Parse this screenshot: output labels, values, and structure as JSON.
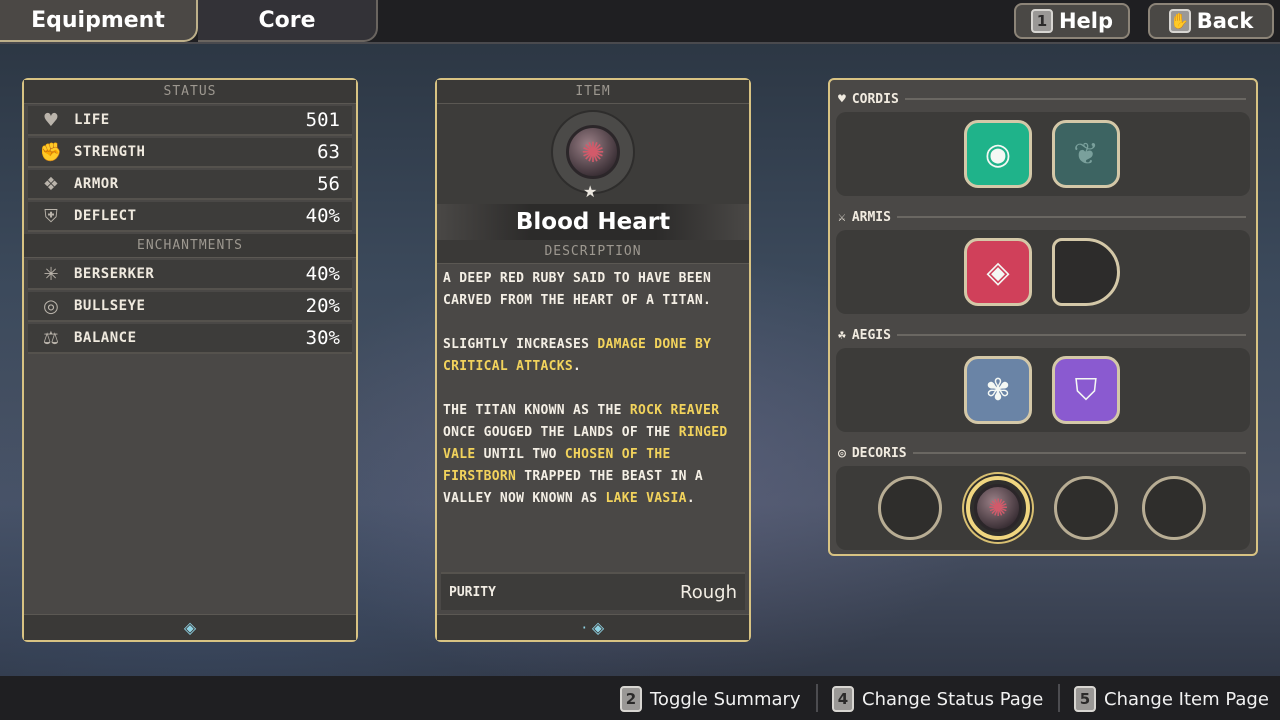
{
  "tabs": [
    {
      "label": "Equipment"
    },
    {
      "label": "Core"
    }
  ],
  "top_buttons": [
    {
      "key": "1",
      "label": "Help"
    },
    {
      "key": "✋",
      "label": "Back"
    }
  ],
  "status": {
    "header": "STATUS",
    "rows": [
      {
        "icon": "heart-icon",
        "glyph": "♥",
        "label": "LIFE",
        "value": "501"
      },
      {
        "icon": "fist-icon",
        "glyph": "✊",
        "label": "STRENGTH",
        "value": "63"
      },
      {
        "icon": "armor-icon",
        "glyph": "❖",
        "label": "ARMOR",
        "value": "56"
      },
      {
        "icon": "shield-icon",
        "glyph": "⛨",
        "label": "DEFLECT",
        "value": "40%"
      }
    ],
    "ench_header": "ENCHANTMENTS",
    "enchantments": [
      {
        "icon": "berserker-icon",
        "glyph": "✳",
        "label": "BERSERKER",
        "value": "40%"
      },
      {
        "icon": "bullseye-icon",
        "glyph": "◎",
        "label": "BULLSEYE",
        "value": "20%"
      },
      {
        "icon": "balance-icon",
        "glyph": "⚖",
        "label": "BALANCE",
        "value": "30%"
      }
    ],
    "footer_glyph": "◈"
  },
  "item": {
    "header": "ITEM",
    "name": "Blood Heart",
    "desc_header": "DESCRIPTION",
    "p1": "A DEEP RED RUBY SAID TO HAVE BEEN CARVED FROM THE HEART OF A TITAN.",
    "p2a": "SLIGHTLY INCREASES ",
    "p2b": "DAMAGE DONE BY CRITICAL ATTACKS",
    "p2c": ".",
    "p3a": "THE TITAN KNOWN AS THE ",
    "p3b": "ROCK REAVER",
    "p3c": " ONCE GOUGED THE LANDS OF THE ",
    "p3d": "RINGED VALE",
    "p3e": " UNTIL TWO ",
    "p3f": "CHOSEN OF THE FIRSTBORN",
    "p3g": " TRAPPED THE BEAST IN A VALLEY NOW KNOWN AS ",
    "p3h": "LAKE VASIA",
    "p3i": ".",
    "purity_label": "PURITY",
    "purity_value": "Rough",
    "footer_glyph": "· ◈"
  },
  "slots": {
    "cordis": {
      "label": "CORDIS",
      "glyph": "♥"
    },
    "armis": {
      "label": "ARMIS",
      "glyph": "⚔"
    },
    "aegis": {
      "label": "AEGIS",
      "glyph": "☘"
    },
    "decoris": {
      "label": "DECORIS",
      "glyph": "◎"
    }
  },
  "colors": {
    "panel_border": "#d8c383",
    "highlight": "#f2d35c",
    "gem_green": "#1fb38a",
    "gem_teal_dim": "#3d6462",
    "gem_red": "#d0405a",
    "gem_blue": "#6a84a6",
    "gem_purple": "#8a5ad0"
  },
  "hints": [
    {
      "key": "2",
      "label": "Toggle Summary"
    },
    {
      "key": "4",
      "label": "Change Status Page"
    },
    {
      "key": "5",
      "label": "Change Item Page"
    }
  ]
}
